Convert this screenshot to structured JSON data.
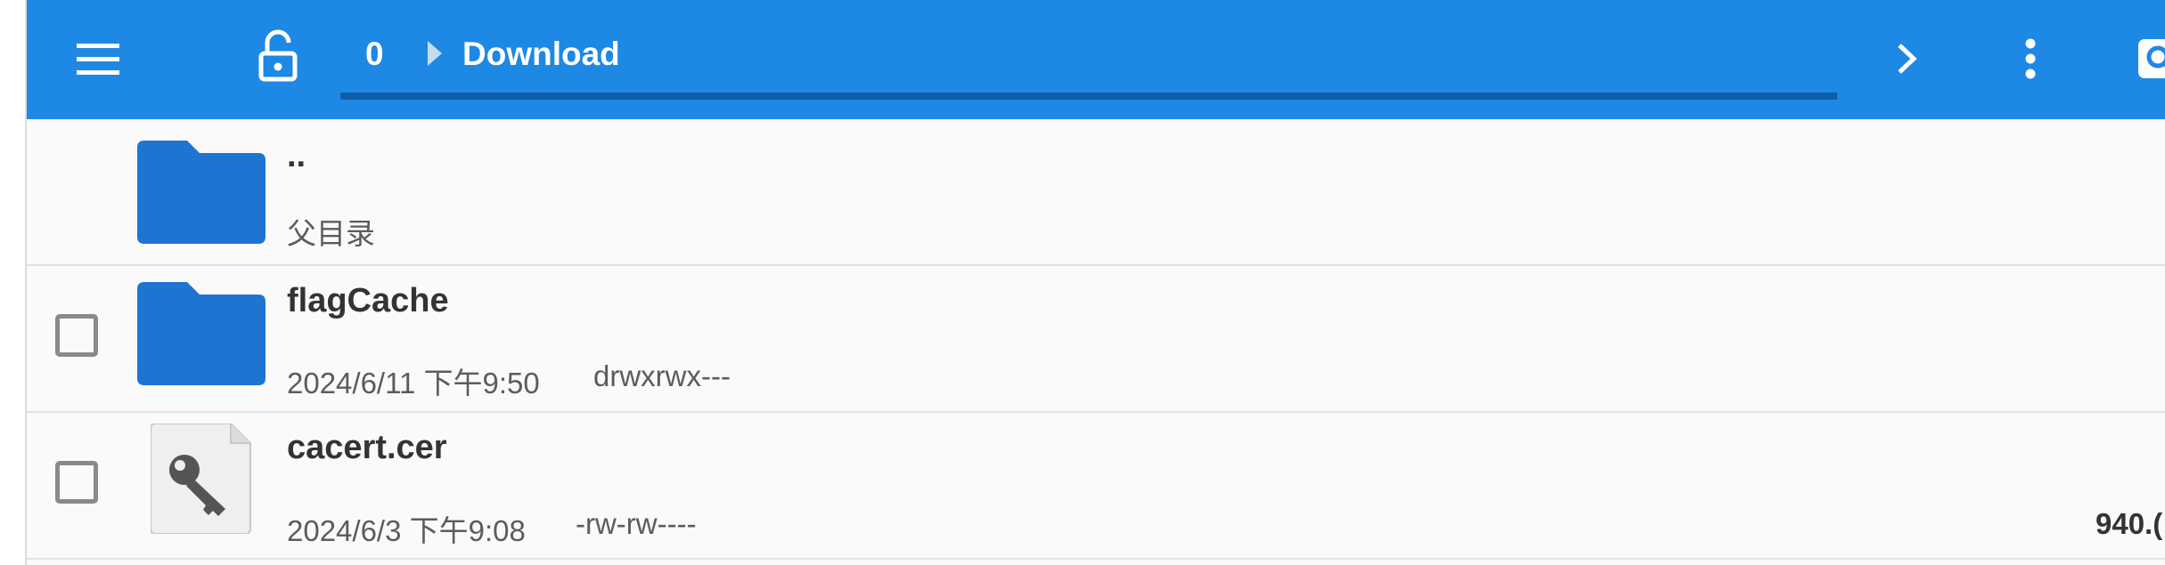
{
  "toolbar": {
    "icons": [
      "hamburger-menu-icon",
      "unlock-icon",
      "chevron-right-icon",
      "more-vertical-icon",
      "search-icon"
    ],
    "breadcrumb": {
      "index": "0",
      "folder": "Download"
    }
  },
  "files": [
    {
      "name": "..",
      "meta": "父目录",
      "type": "folder-icon",
      "checkbox": false
    },
    {
      "name": "flagCache",
      "date": "2024/6/11 下午9:50",
      "perms": "drwxrwx---",
      "type": "folder-icon",
      "checkbox": true
    },
    {
      "name": "cacert.cer",
      "date": "2024/6/3 下午9:08",
      "perms": "-rw-rw----",
      "size": "940.(",
      "type": "key-file-icon",
      "checkbox": true
    }
  ],
  "colors": {
    "toolbar": "#1e88e5",
    "folder": "#1e74d1",
    "path_underline": "#0f5ea8"
  }
}
